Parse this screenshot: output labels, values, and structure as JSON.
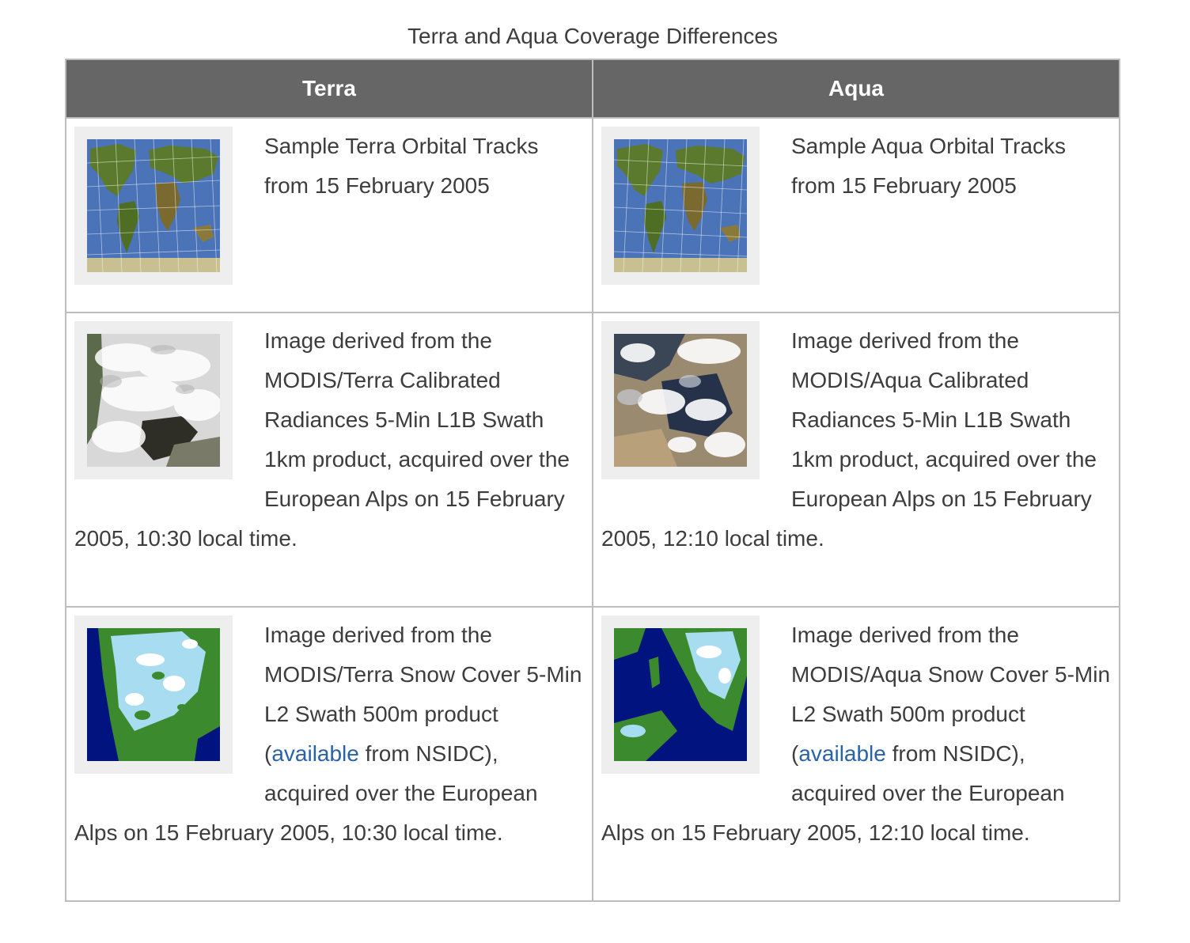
{
  "caption": "Terra and Aqua Coverage Differences",
  "columns": [
    "Terra",
    "Aqua"
  ],
  "colors": {
    "header_bg": "#666666",
    "border": "#bdbdbd",
    "link": "#2a62a8",
    "ocean": "#4b73b8",
    "snow_ocean": "#00137f",
    "snow": "#a8dcf0",
    "land": "#3c8a2e"
  },
  "rows": [
    {
      "terra": {
        "image": "world-orbital-tracks-map",
        "text": "Sample Terra Orbital Tracks from 15 February 2005"
      },
      "aqua": {
        "image": "world-orbital-tracks-map",
        "text": "Sample Aqua Orbital Tracks from 15 February 2005"
      }
    },
    {
      "terra": {
        "image": "cloudy-alps-satellite-image",
        "text": "Image derived from the MODIS/Terra Calibrated Radiances 5-Min L1B Swath 1km product, acquired over the European Alps on 15 February 2005, 10:30 local time."
      },
      "aqua": {
        "image": "cloudy-alps-satellite-image",
        "text": "Image derived from the MODIS/Aqua Calibrated Radiances 5-Min L1B Swath 1km product, acquired over the European Alps on 15 February 2005, 12:10 local time."
      }
    },
    {
      "terra": {
        "image": "snow-cover-map",
        "text_before": "Image derived from the MODIS/Terra Snow Cover 5-Min L2 Swath 500m product (",
        "link": "available",
        "text_after": " from NSIDC), acquired over the European Alps on 15 February 2005, 10:30 local time."
      },
      "aqua": {
        "image": "snow-cover-map",
        "text_before": "Image derived from the MODIS/Aqua Snow Cover 5-Min L2 Swath 500m product (",
        "link": "available",
        "text_after": " from NSIDC), acquired over the European Alps on 15 February 2005, 12:10 local time."
      }
    }
  ]
}
